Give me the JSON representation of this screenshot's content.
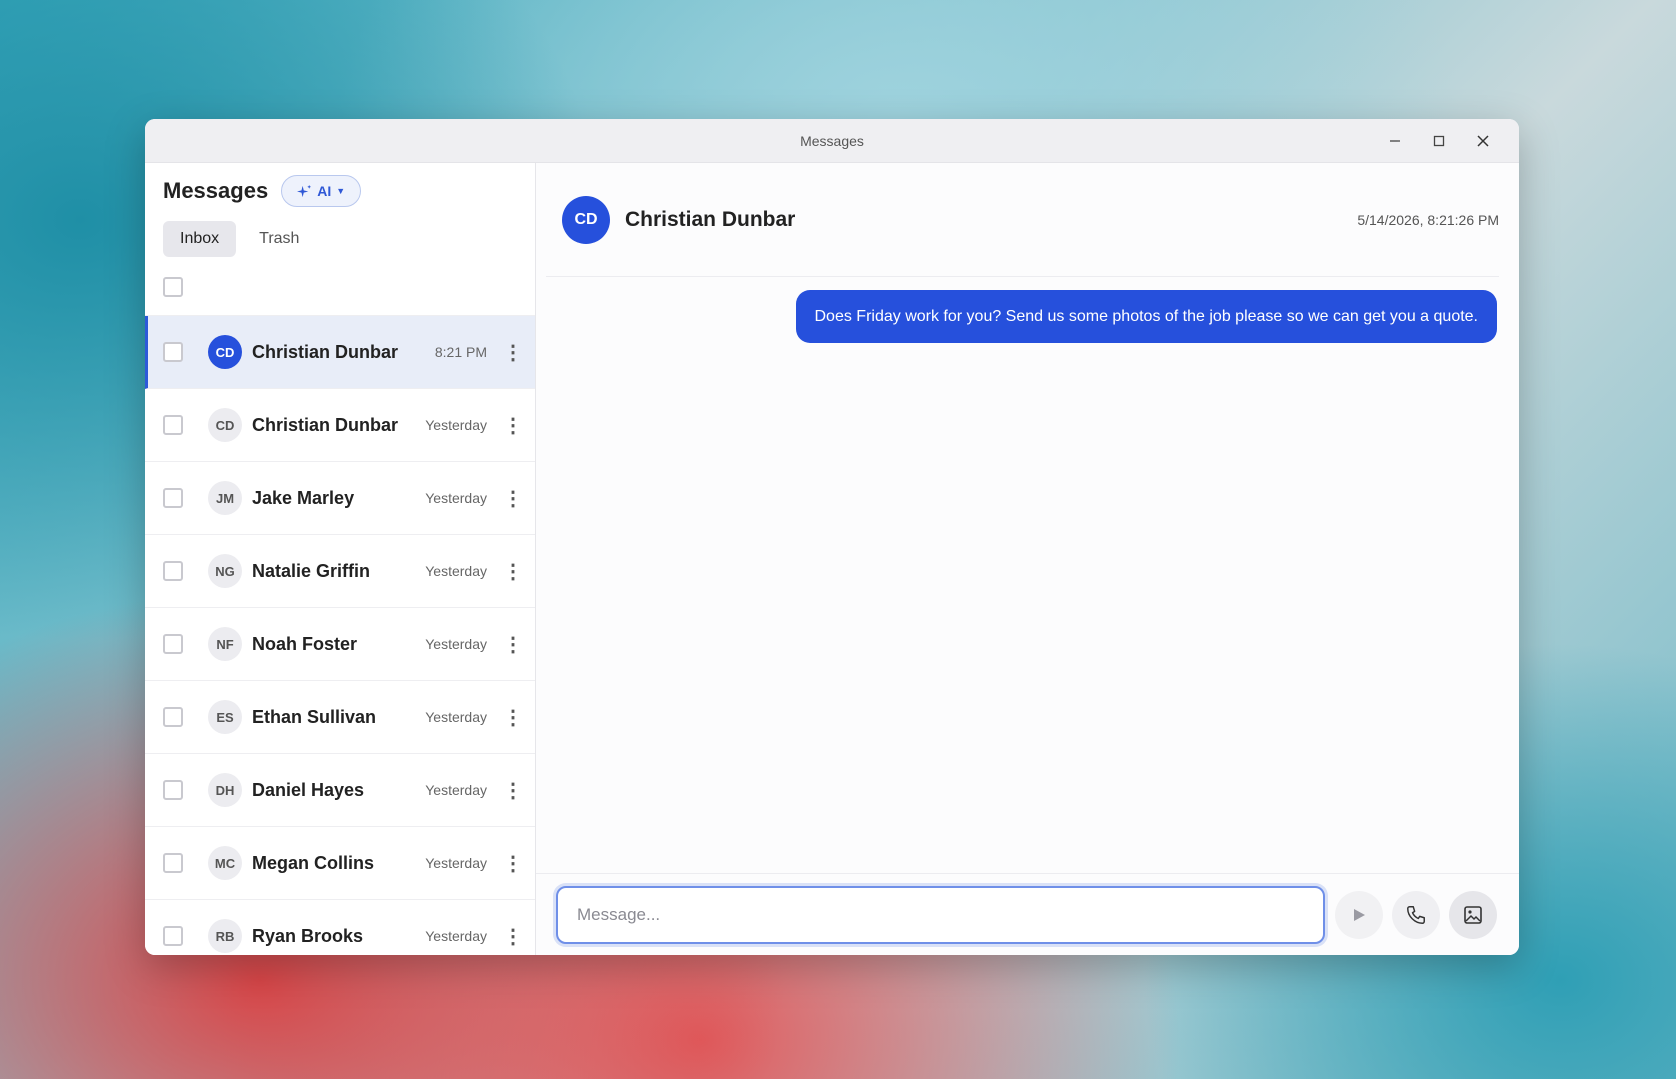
{
  "window": {
    "title": "Messages"
  },
  "sidebar": {
    "title": "Messages",
    "ai_label": "AI",
    "tabs": [
      {
        "label": "Inbox",
        "active": true
      },
      {
        "label": "Trash",
        "active": false
      }
    ],
    "conversations": [
      {
        "initials": "CD",
        "name": "Christian Dunbar",
        "time": "8:21 PM",
        "selected": true
      },
      {
        "initials": "CD",
        "name": "Christian Dunbar",
        "time": "Yesterday",
        "selected": false
      },
      {
        "initials": "JM",
        "name": "Jake Marley",
        "time": "Yesterday",
        "selected": false
      },
      {
        "initials": "NG",
        "name": "Natalie Griffin",
        "time": "Yesterday",
        "selected": false
      },
      {
        "initials": "NF",
        "name": "Noah Foster",
        "time": "Yesterday",
        "selected": false
      },
      {
        "initials": "ES",
        "name": "Ethan Sullivan",
        "time": "Yesterday",
        "selected": false
      },
      {
        "initials": "DH",
        "name": "Daniel Hayes",
        "time": "Yesterday",
        "selected": false
      },
      {
        "initials": "MC",
        "name": "Megan Collins",
        "time": "Yesterday",
        "selected": false
      },
      {
        "initials": "RB",
        "name": "Ryan Brooks",
        "time": "Yesterday",
        "selected": false
      }
    ]
  },
  "chat": {
    "contact_initials": "CD",
    "contact_name": "Christian Dunbar",
    "datetime": "5/14/2026, 8:21:26 PM",
    "messages": [
      {
        "text": "Does Friday work for you? Send us some photos of the job please so we can get you a quote.",
        "outgoing": true
      }
    ]
  },
  "composer": {
    "placeholder": "Message...",
    "value": ""
  },
  "colors": {
    "accent": "#2650dc",
    "selected_row": "#e8edf8"
  }
}
